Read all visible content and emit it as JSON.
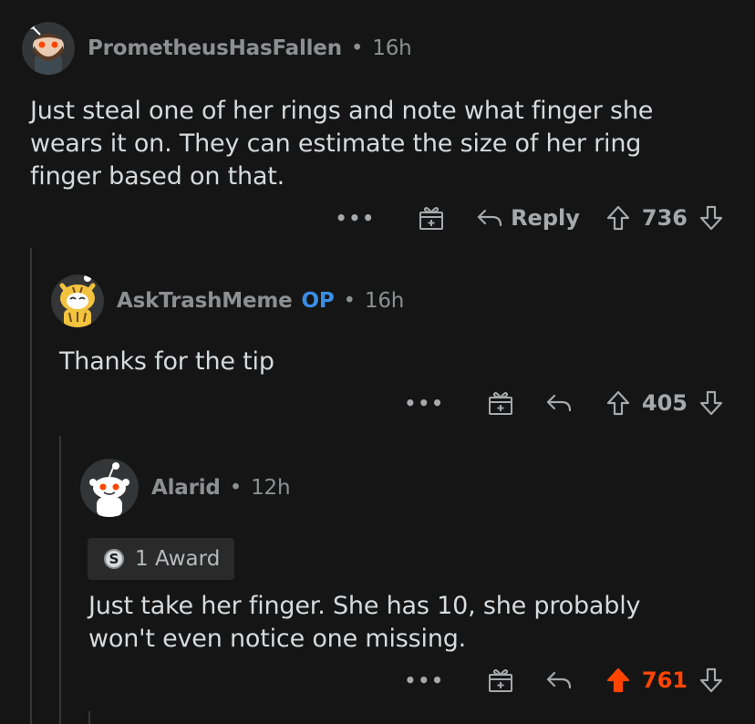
{
  "comments": [
    {
      "author": "PrometheusHasFallen",
      "op_badge": "",
      "time": "16h",
      "body_lines": [
        "Just steal one of her rings and note what finger she",
        "wears it on. They can estimate the size of her ring",
        "finger based on that."
      ],
      "actions": {
        "more": "•••",
        "reply_label": "Reply",
        "score": "736",
        "upvoted": false
      }
    },
    {
      "author": "AskTrashMeme",
      "op_badge": "OP",
      "time": "16h",
      "body_lines": [
        "Thanks for the tip"
      ],
      "actions": {
        "more": "•••",
        "reply_label": "",
        "score": "405",
        "upvoted": false
      }
    },
    {
      "author": "Alarid",
      "op_badge": "",
      "time": "12h",
      "award": {
        "icon_letter": "S",
        "label": "1 Award"
      },
      "body_lines": [
        "Just take her finger. She has 10, she probably",
        "won't even notice one missing."
      ],
      "actions": {
        "more": "•••",
        "reply_label": "",
        "score": "761",
        "upvoted": true
      }
    }
  ],
  "separator": "•",
  "icons": [
    "avatar-snoo-bearded",
    "avatar-snoo-tiger",
    "avatar-snoo-default",
    "gift-award-icon",
    "reply-arrow-icon",
    "upvote-arrow-icon",
    "downvote-arrow-icon"
  ],
  "colors": {
    "background": "#151515",
    "text": "#d7dadc",
    "muted": "#8d9091",
    "op": "#3a8ee6",
    "upvote": "#ff4500"
  }
}
